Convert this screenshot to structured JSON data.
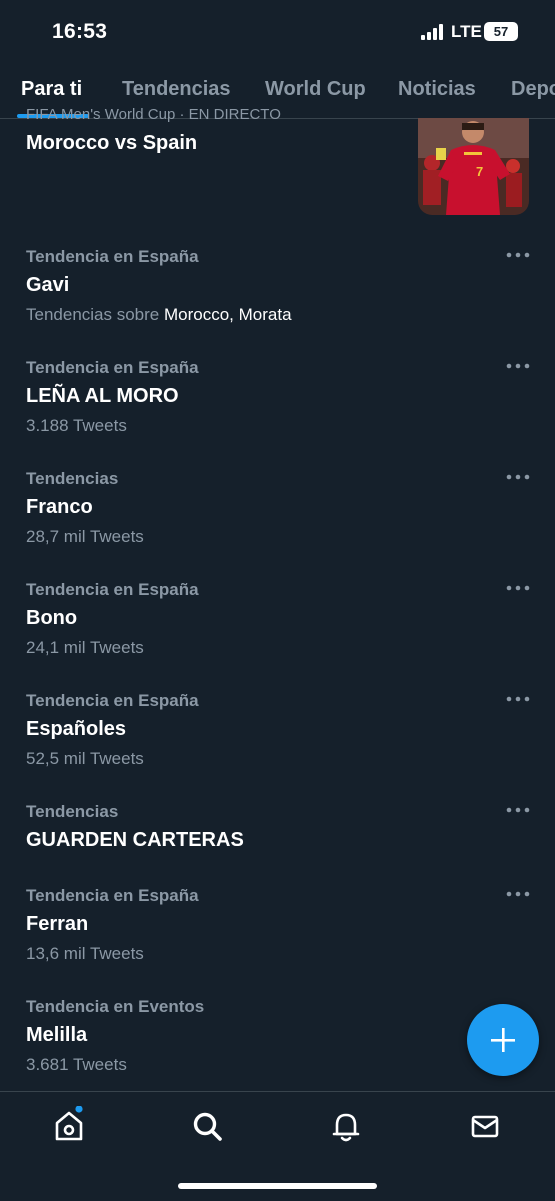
{
  "status_bar": {
    "time": "16:53",
    "network": "LTE",
    "battery": "57"
  },
  "tabs": [
    {
      "label": "Para ti",
      "active": true
    },
    {
      "label": "Tendencias",
      "active": false
    },
    {
      "label": "World Cup",
      "active": false
    },
    {
      "label": "Noticias",
      "active": false
    },
    {
      "label": "Depo",
      "active": false
    }
  ],
  "event": {
    "context": "FIFA Men's World Cup · EN DIRECTO",
    "title": "Morocco vs Spain",
    "thumbnail_icon": "football-player-photo"
  },
  "trends": [
    {
      "context": "Tendencia en España",
      "name": "Gavi",
      "meta_prefix": "Tendencias sobre ",
      "meta_highlight": "Morocco, Morata",
      "meta": ""
    },
    {
      "context": "Tendencia en España",
      "name": "LEÑA AL MORO",
      "meta": "3.188 Tweets"
    },
    {
      "context": "Tendencias",
      "name": "Franco",
      "meta": "28,7 mil Tweets"
    },
    {
      "context": "Tendencia en España",
      "name": "Bono",
      "meta": "24,1 mil Tweets"
    },
    {
      "context": "Tendencia en España",
      "name": "Españoles",
      "meta": "52,5 mil Tweets"
    },
    {
      "context": "Tendencias",
      "name": "GUARDEN CARTERAS",
      "meta": ""
    },
    {
      "context": "Tendencia en España",
      "name": "Ferran",
      "meta": "13,6 mil Tweets"
    },
    {
      "context": "Tendencia en Eventos",
      "name": "Melilla",
      "meta": "3.681 Tweets"
    }
  ],
  "fab": {
    "icon": "plus-icon"
  },
  "bottom_nav": [
    {
      "icon": "home-icon",
      "notification_dot": true
    },
    {
      "icon": "search-icon",
      "active": true
    },
    {
      "icon": "bell-icon"
    },
    {
      "icon": "mail-icon"
    }
  ],
  "colors": {
    "background": "#15202b",
    "accent": "#1d9bf0",
    "secondary_text": "#8b98a5",
    "divider": "#38444d"
  }
}
